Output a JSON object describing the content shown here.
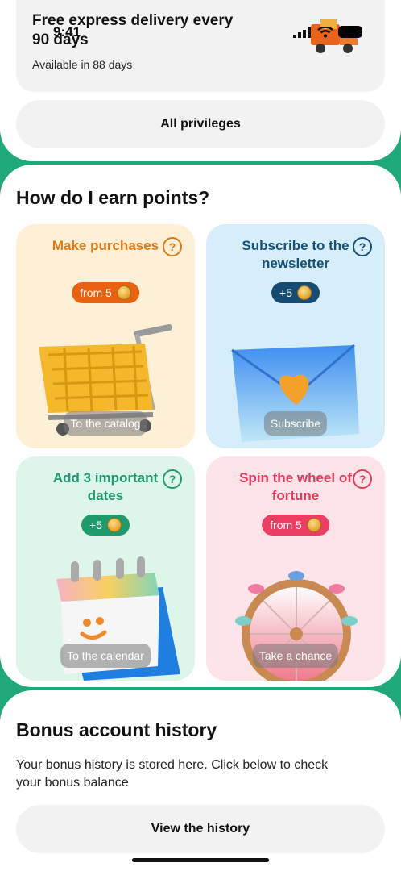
{
  "status": {
    "time": "9:41"
  },
  "delivery": {
    "title": "Free express delivery every 90 days",
    "subtitle": "Available in 88 days"
  },
  "privileges_button": "All privileges",
  "earn": {
    "title": "How do I earn points?",
    "cards": [
      {
        "title": "Make purchases",
        "badge": "from 5",
        "action": "To the catalog",
        "help": "?"
      },
      {
        "title": "Subscribe to the newsletter",
        "badge": "+5",
        "action": "Subscribe",
        "help": "?"
      },
      {
        "title": "Add 3 important dates",
        "badge": "+5",
        "action": "To the calendar",
        "help": "?"
      },
      {
        "title": "Spin the wheel of fortune",
        "badge": "from 5",
        "action": "Take a chance",
        "help": "?"
      }
    ]
  },
  "history": {
    "title": "Bonus account history",
    "text": "Your bonus history is stored here. Click below to check your bonus balance",
    "button": "View the history"
  },
  "colors": {
    "background": "#1fa97a",
    "orange": "#e8620f",
    "navy": "#154b74",
    "green": "#1f9a6b",
    "pink": "#ec3d62"
  },
  "icons": [
    "signal-icon",
    "wifi-icon",
    "battery-icon",
    "truck-icon",
    "help-icon",
    "coin-icon",
    "cart-icon",
    "envelope-icon",
    "calendar-icon",
    "wheel-icon"
  ]
}
